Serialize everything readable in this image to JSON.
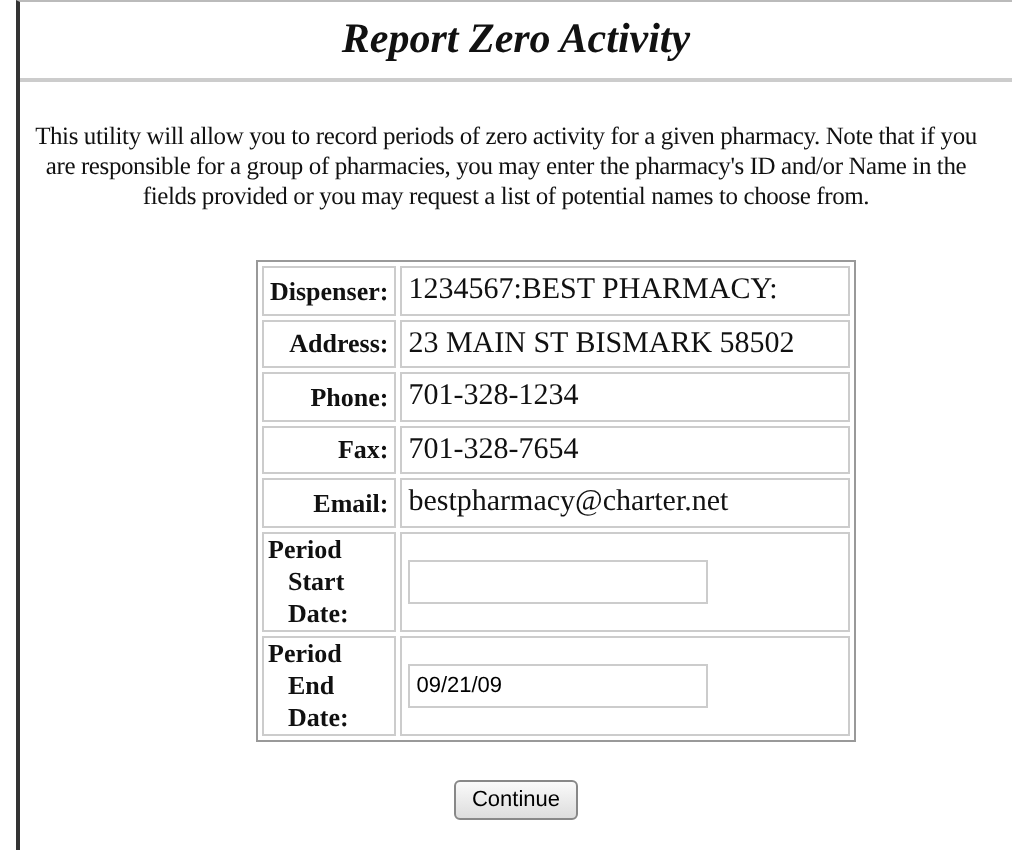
{
  "title": "Report Zero Activity",
  "intro": "This utility will allow you to record periods of zero activity for a given pharmacy. Note that if you are responsible for a group of pharmacies, you may enter the pharmacy's ID and/or Name in the fields provided or you may request a list of potential names to choose from.",
  "fields": [
    {
      "kind": "text",
      "label": "Dispenser:",
      "value": "1234567:BEST PHARMACY:"
    },
    {
      "kind": "text",
      "label": "Address:",
      "value": "23 MAIN ST BISMARK 58502"
    },
    {
      "kind": "text",
      "label": "Phone:",
      "value": "701-328-1234"
    },
    {
      "kind": "text",
      "label": "Fax:",
      "value": "701-328-7654"
    },
    {
      "kind": "text",
      "label": "Email:",
      "value": "bestpharmacy@charter.net"
    },
    {
      "kind": "input",
      "label": "Period Start Date:"
    },
    {
      "kind": "input",
      "label": "Period End Date:",
      "value": "09/21/09"
    }
  ],
  "button": "Continue"
}
